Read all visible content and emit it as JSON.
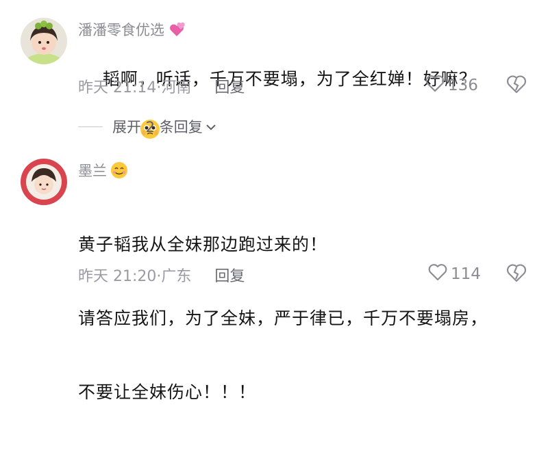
{
  "comments": [
    {
      "username": "潘潘零食优选",
      "username_emoji": "hearts-icon",
      "text": "韬啊，听话，千万不要塌，为了全红婵！好嘛？",
      "text_emoji": "pleading-face-icon",
      "time": "昨天 21:14·河南",
      "reply_label": "回复",
      "likes": "136"
    },
    {
      "username": "墨兰",
      "username_emoji": "smile-icon",
      "text_lines": [
        "黄子韬我从全妹那边跑过来的！",
        "请答应我们，为了全妹，严于律已，千万不要塌房，",
        "不要让全妹伤心！！！"
      ],
      "time": "昨天 21:20·广东",
      "reply_label": "回复",
      "likes": "114"
    }
  ],
  "expand_replies": {
    "label": "展开 2 条回复"
  },
  "colors": {
    "meta": "#9a9aa2",
    "text": "#141414",
    "heart": "#e85fa8"
  }
}
